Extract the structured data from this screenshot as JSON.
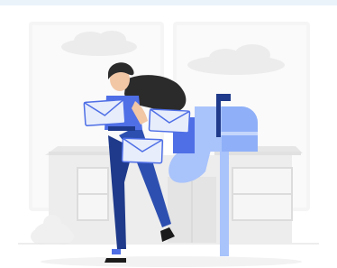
{
  "colors": {
    "top_strip": "#eaf2fa",
    "background": "#ffffff",
    "backdrop": "#f4f4f4",
    "house": "#e6e6e6",
    "accent_blue": "#4f6fe6",
    "light_blue": "#a9c3fb",
    "navy": "#1f3a8a",
    "skin": "#f2c7a6",
    "hair": "#2b2b2b"
  },
  "illustration": {
    "subject": "woman-carrying-letters-to-mailbox"
  }
}
